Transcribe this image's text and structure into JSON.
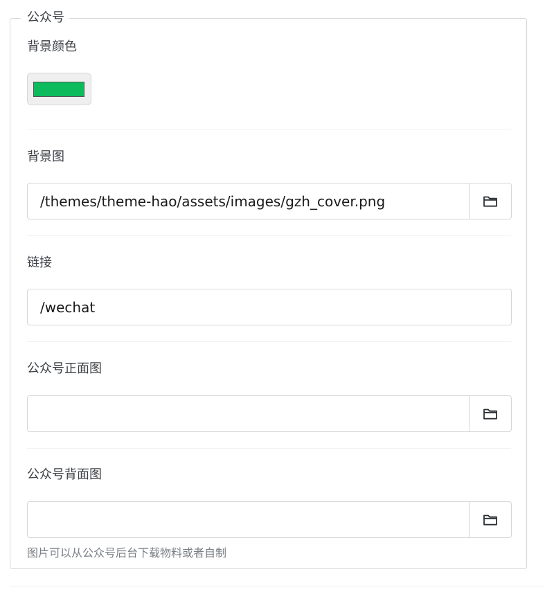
{
  "section": {
    "legend": "公众号"
  },
  "fields": {
    "bg_color": {
      "label": "背景颜色",
      "value": "#0cbc5c"
    },
    "bg_image": {
      "label": "背景图",
      "value": "/themes/theme-hao/assets/images/gzh_cover.png"
    },
    "link": {
      "label": "链接",
      "value": "/wechat"
    },
    "front_image": {
      "label": "公众号正面图",
      "value": ""
    },
    "back_image": {
      "label": "公众号背面图",
      "value": "",
      "help": "图片可以从公众号后台下载物料或者自制"
    }
  },
  "icons": {
    "browse": "folder-icon"
  }
}
